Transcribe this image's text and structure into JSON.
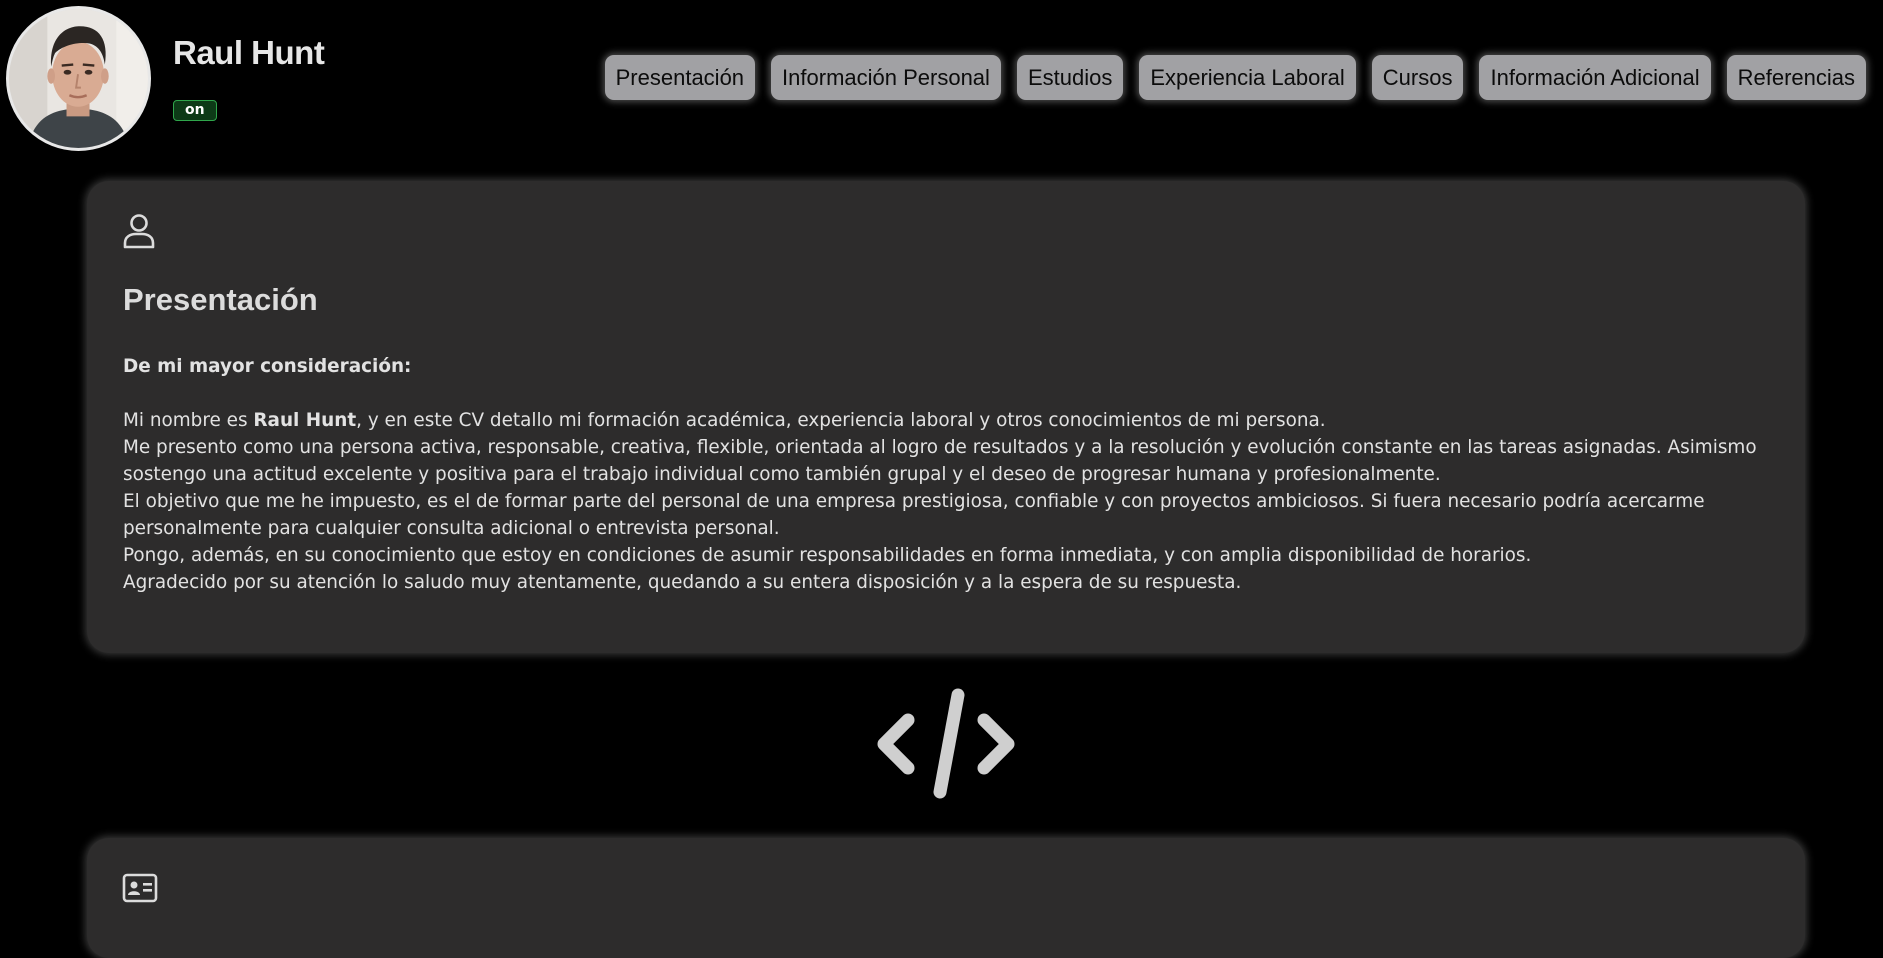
{
  "profile": {
    "name": "Raul Hunt",
    "status": "on",
    "avatar_icon": "profile-photo"
  },
  "nav": {
    "items": [
      {
        "label": "Presentación"
      },
      {
        "label": "Información Personal"
      },
      {
        "label": "Estudios"
      },
      {
        "label": "Experiencia Laboral"
      },
      {
        "label": "Cursos"
      },
      {
        "label": "Información Adicional"
      },
      {
        "label": "Referencias"
      }
    ]
  },
  "presentacion": {
    "icon": "user-icon",
    "title": "Presentación",
    "salutation": "De mi mayor consideración:",
    "p1_before": "Mi nombre es ",
    "p1_name": "Raul Hunt",
    "p1_after": ", y en este CV detallo mi formación académica, experiencia laboral y otros conocimientos de mi persona.",
    "p2": "Me presento como una persona activa, responsable, creativa, flexible, orientada al logro de resultados y a la resolución y evolución constante en las tareas asignadas. Asimismo sostengo una actitud excelente y positiva para el trabajo individual como también grupal y el deseo de progresar humana y profesionalmente.",
    "p3": "El objetivo que me he impuesto, es el de formar parte del personal de una empresa prestigiosa, confiable y con proyectos ambiciosos. Si fuera necesario podría acercarme personalmente para cualquier consulta adicional o entrevista personal.",
    "p4": "Pongo, además, en su conocimiento que estoy en condiciones de asumir responsabilidades en forma inmediata, y con amplia disponibilidad de horarios.",
    "p5": "Agradecido por su atención lo saludo muy atentamente, quedando a su entera disposición y a la espera de su respuesta."
  },
  "separator": {
    "icon": "code-icon"
  },
  "info_personal": {
    "icon": "id-card-icon"
  },
  "colors": {
    "background": "#000000",
    "card": "#2d2c2c",
    "nav_button": "#a1a1a4",
    "status_green": "#2fa64b"
  }
}
